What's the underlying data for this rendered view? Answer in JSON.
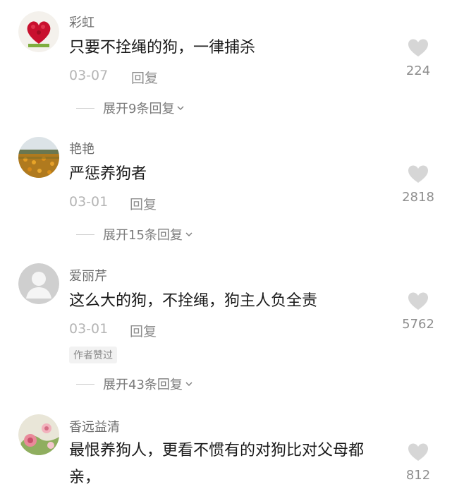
{
  "comments": [
    {
      "username": "彩虹",
      "text": "只要不拴绳的狗，一律捕杀",
      "date": "03-07",
      "reply_label": "回复",
      "expand_label": "展开9条回复",
      "likes": "224",
      "avatar": "red-heart-flowers-avatar"
    },
    {
      "username": "艳艳",
      "text": "严惩养狗者",
      "date": "03-01",
      "reply_label": "回复",
      "expand_label": "展开15条回复",
      "likes": "2818",
      "avatar": "flower-field-avatar"
    },
    {
      "username": "爱丽芹",
      "text": "这么大的狗，不拴绳，狗主人负全责",
      "date": "03-01",
      "reply_label": "回复",
      "badge": "作者赞过",
      "expand_label": "展开43条回复",
      "likes": "5762",
      "avatar": "default-user-avatar"
    },
    {
      "username": "香远益清",
      "text": "最恨养狗人，更看不惯有的对狗比对父母都亲，",
      "likes": "812",
      "avatar": "pink-flower-avatar"
    }
  ],
  "colors": {
    "heart": "#d6d6d6",
    "username": "#6f6f6f",
    "text": "#1a1a1a",
    "meta": "#b5b5b5"
  }
}
